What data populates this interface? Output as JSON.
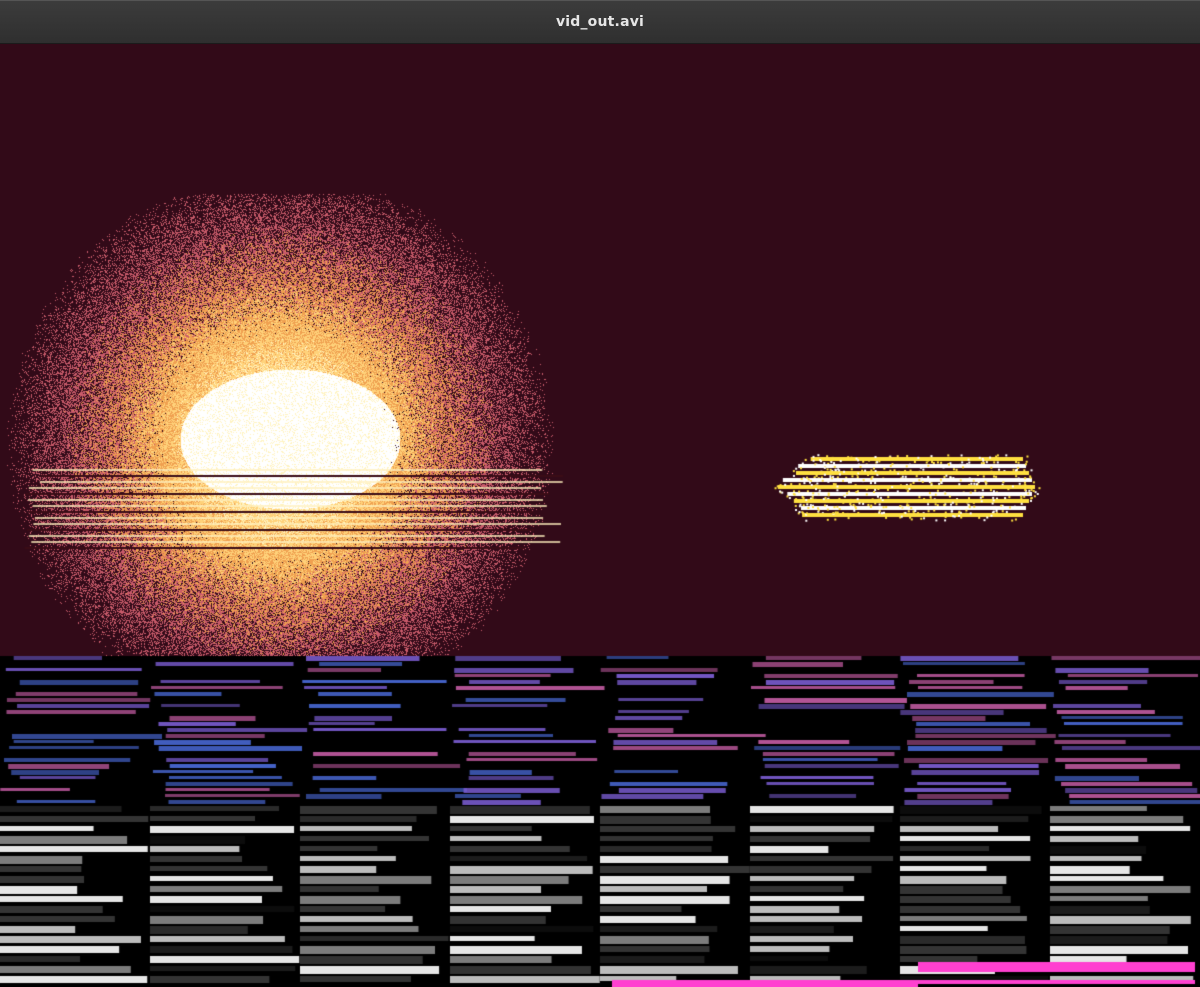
{
  "window": {
    "title": "vid_out.avi"
  },
  "video": {
    "background_color": "#320a18",
    "glow_colors": [
      "#ffffff",
      "#fff3c0",
      "#ffd27a",
      "#f0a050",
      "#c85a6a"
    ],
    "streak_colors": [
      "#ffe040",
      "#ffffff",
      "#3a0c16"
    ],
    "glitch_colors": [
      "#7a5cd0",
      "#c05aa0",
      "#4a6ad8",
      "#ffffff",
      "#d0d0d0",
      "#8a8a8a",
      "#3a3a3a"
    ],
    "magenta_color": "#ff40d0"
  }
}
